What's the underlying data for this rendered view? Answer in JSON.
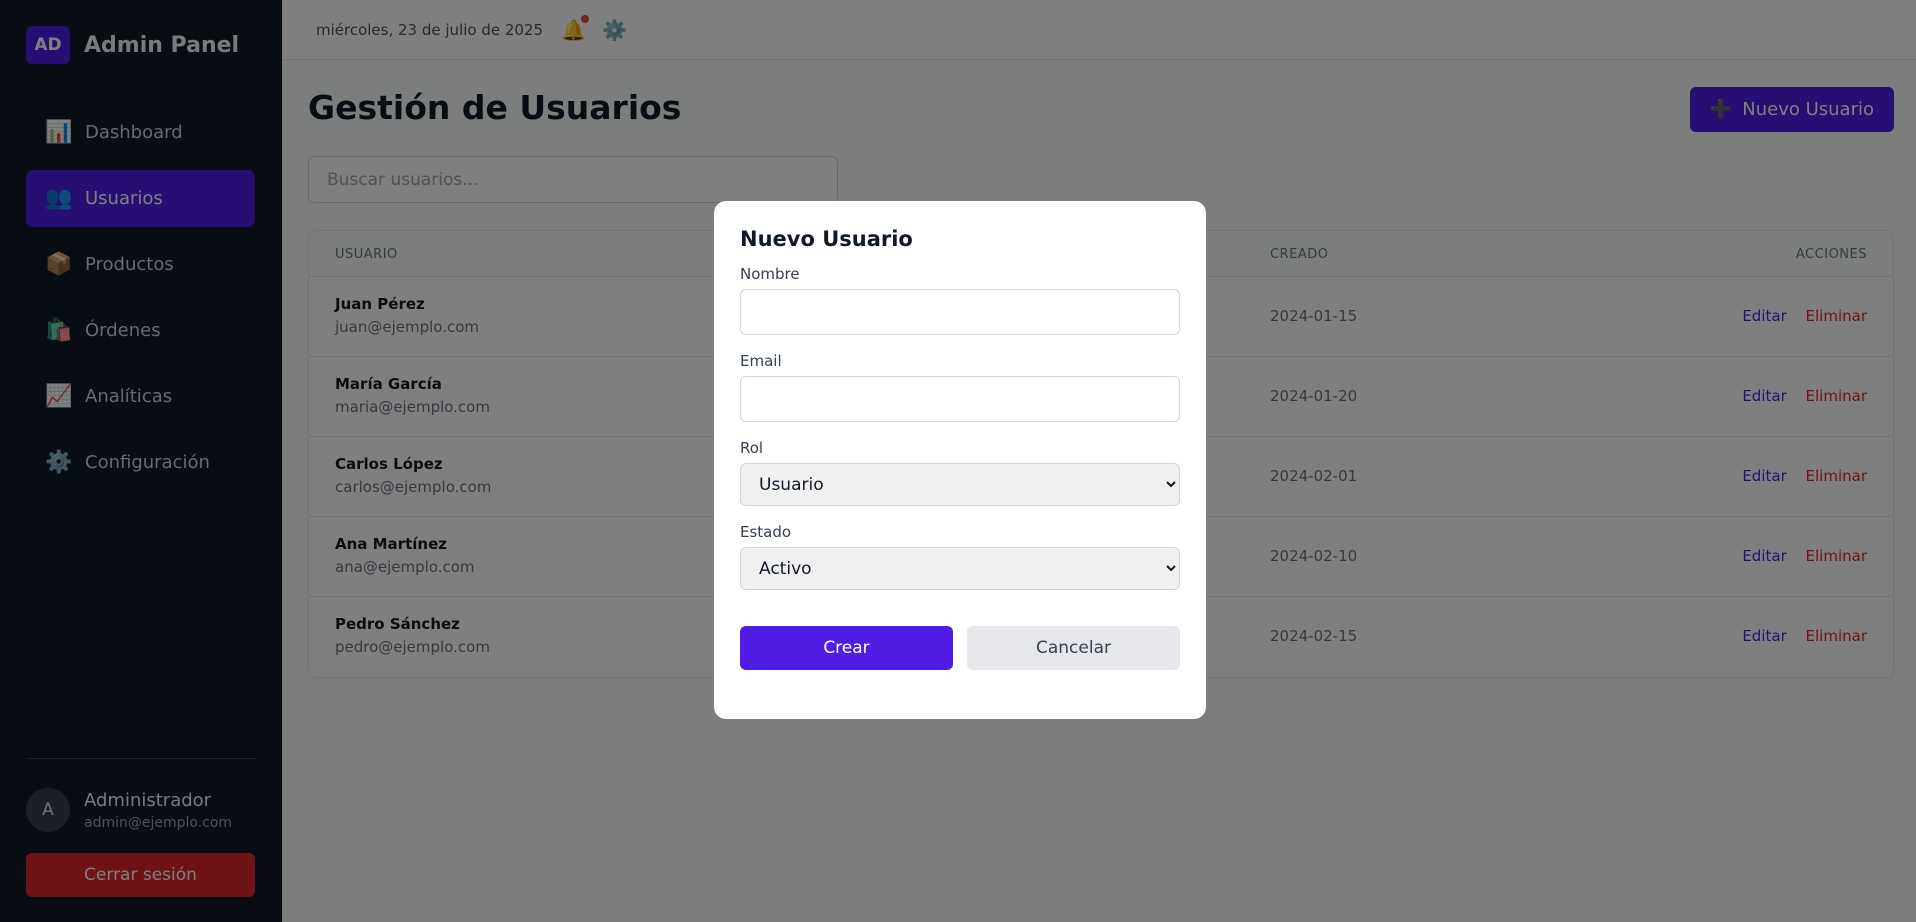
{
  "sidebar": {
    "logo": "AD",
    "title": "Admin Panel",
    "items": [
      {
        "label": "Dashboard",
        "icon": "📊",
        "active": false
      },
      {
        "label": "Usuarios",
        "icon": "👥",
        "active": true
      },
      {
        "label": "Productos",
        "icon": "📦",
        "active": false
      },
      {
        "label": "Órdenes",
        "icon": "🛍️",
        "active": false
      },
      {
        "label": "Analíticas",
        "icon": "📈",
        "active": false
      },
      {
        "label": "Configuración",
        "icon": "⚙️",
        "active": false
      }
    ],
    "user": {
      "initial": "A",
      "name": "Administrador",
      "email": "admin@ejemplo.com"
    },
    "logout_label": "Cerrar sesión"
  },
  "topbar": {
    "date": "miércoles, 23 de julio de 2025",
    "bell_icon": "🔔",
    "gear_icon": "⚙️"
  },
  "main": {
    "title": "Gestión de Usuarios",
    "new_user_icon": "➕",
    "new_user_label": "Nuevo Usuario",
    "search_placeholder": "Buscar usuarios...",
    "table": {
      "headers": {
        "user": "USUARIO",
        "created": "CREADO",
        "actions": "ACCIONES"
      },
      "rows": [
        {
          "name": "Juan Pérez",
          "email": "juan@ejemplo.com",
          "created": "2024-01-15"
        },
        {
          "name": "María García",
          "email": "maria@ejemplo.com",
          "created": "2024-01-20"
        },
        {
          "name": "Carlos López",
          "email": "carlos@ejemplo.com",
          "created": "2024-02-01"
        },
        {
          "name": "Ana Martínez",
          "email": "ana@ejemplo.com",
          "created": "2024-02-10"
        },
        {
          "name": "Pedro Sánchez",
          "email": "pedro@ejemplo.com",
          "created": "2024-02-15"
        }
      ],
      "edit_label": "Editar",
      "delete_label": "Eliminar"
    }
  },
  "modal": {
    "title": "Nuevo Usuario",
    "name_label": "Nombre",
    "name_value": "",
    "email_label": "Email",
    "email_value": "",
    "role_label": "Rol",
    "role_value": "Usuario",
    "status_label": "Estado",
    "status_value": "Activo",
    "create_label": "Crear",
    "cancel_label": "Cancelar"
  },
  "colors": {
    "accent": "#4f1de6",
    "danger": "#dc2626",
    "sidebar_bg": "#111827"
  }
}
